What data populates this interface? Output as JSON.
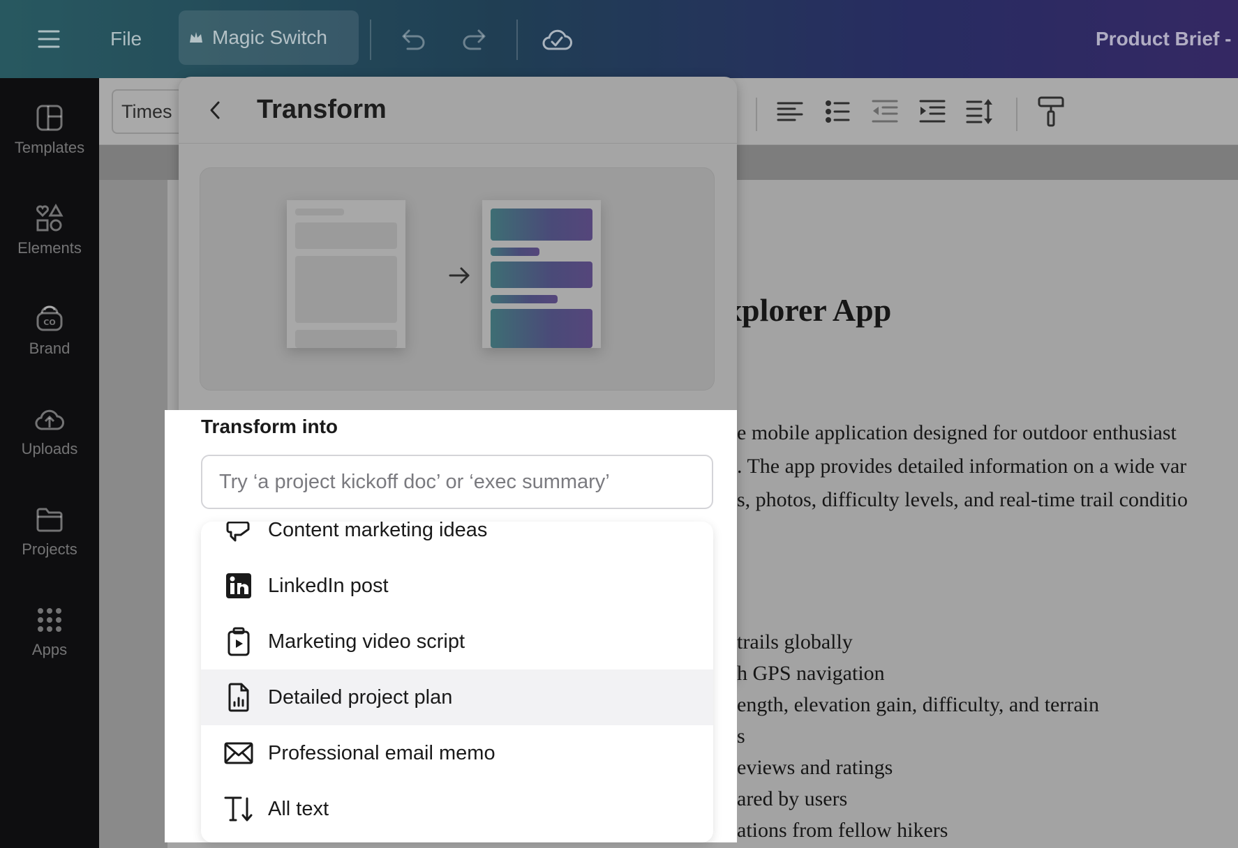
{
  "topbar": {
    "file_label": "File",
    "magic_switch_label": "Magic Switch",
    "doc_title": "Product Brief -"
  },
  "rail": {
    "items": [
      {
        "label": "Templates",
        "icon": "templates-icon"
      },
      {
        "label": "Elements",
        "icon": "elements-icon"
      },
      {
        "label": "Brand",
        "icon": "brand-icon"
      },
      {
        "label": "Uploads",
        "icon": "uploads-icon"
      },
      {
        "label": "Projects",
        "icon": "projects-icon"
      },
      {
        "label": "Apps",
        "icon": "apps-icon"
      }
    ]
  },
  "toolbar": {
    "font_family": "Times"
  },
  "document": {
    "heading": "xplorer App",
    "paragraph_lines": [
      "e mobile application designed for outdoor enthusiast",
      ". The app provides detailed information on a wide var",
      "s, photos, difficulty levels, and real-time trail conditio"
    ],
    "bullets": [
      "trails globally",
      "h GPS navigation",
      "ength, elevation gain, difficulty, and terrain",
      "s",
      "eviews and ratings",
      "ared by users",
      "ations from fellow hikers"
    ]
  },
  "panel": {
    "title": "Transform",
    "section_label": "Transform into",
    "input_placeholder": "Try ‘a project kickoff doc’ or ‘exec summary’",
    "options": [
      {
        "label": "Content marketing ideas",
        "icon": "megaphone-icon",
        "highlighted": false
      },
      {
        "label": "LinkedIn post",
        "icon": "linkedin-icon",
        "highlighted": false
      },
      {
        "label": "Marketing video script",
        "icon": "video-script-icon",
        "highlighted": false
      },
      {
        "label": "Detailed project plan",
        "icon": "project-plan-icon",
        "highlighted": true
      },
      {
        "label": "Professional email memo",
        "icon": "email-icon",
        "highlighted": false
      },
      {
        "label": "All text",
        "icon": "text-icon",
        "highlighted": false
      }
    ]
  },
  "colors": {
    "accent_gradient_start": "#3e6e74",
    "accent_gradient_end": "#55467b",
    "highlight_row": "#f2f2f4"
  }
}
